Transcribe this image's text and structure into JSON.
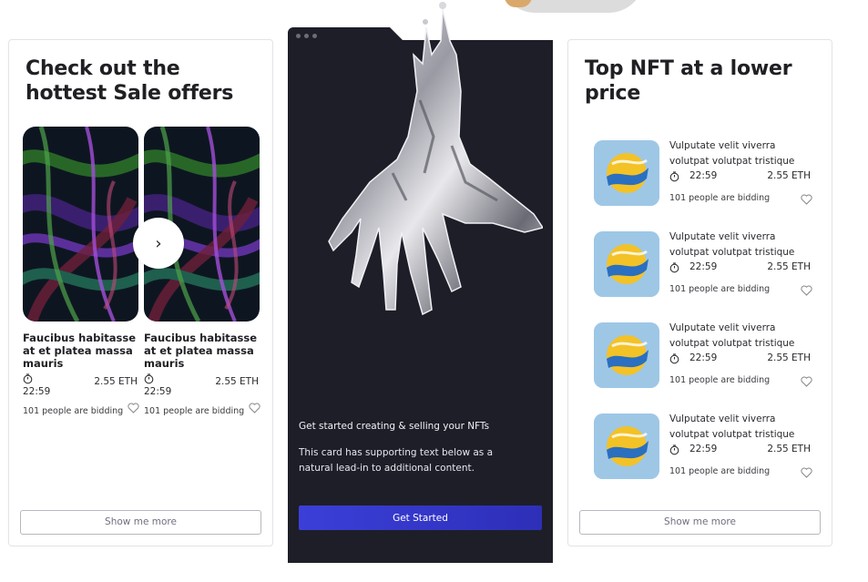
{
  "left_card": {
    "title": "Check out the hottest Sale offers",
    "items": [
      {
        "name": "Faucibus habitasse at et platea massa mauris",
        "time": "22:59",
        "price": "2.55 ETH",
        "bidding": "101 people are bidding"
      },
      {
        "name": "Faucibus habitasse at et platea massa mauris",
        "time": "22:59",
        "price": "2.55 ETH",
        "bidding": "101 people are bidding"
      }
    ],
    "next_icon": "›",
    "show_more": "Show me more"
  },
  "center_card": {
    "heading": "Get started creating & selling your NFTs",
    "text": "This card has supporting text below as a natural lead-in to additional content.",
    "button": "Get Started",
    "colors": {
      "background": "#1e1e28",
      "button": "#3338c9"
    }
  },
  "right_card": {
    "title": "Top NFT at a lower price",
    "items": [
      {
        "title": "Vulputate velit viverra volutpat volutpat tristique",
        "time": "22:59",
        "price": "2.55 ETH",
        "bidding": "101 people are bidding"
      },
      {
        "title": "Vulputate velit viverra volutpat volutpat tristique",
        "time": "22:59",
        "price": "2.55 ETH",
        "bidding": "101 people are bidding"
      },
      {
        "title": "Vulputate velit viverra volutpat volutpat tristique",
        "time": "22:59",
        "price": "2.55 ETH",
        "bidding": "101 people are bidding"
      },
      {
        "title": "Vulputate velit viverra volutpat volutpat tristique",
        "time": "22:59",
        "price": "2.55 ETH",
        "bidding": "101 people are bidding"
      }
    ],
    "show_more": "Show me more"
  },
  "icons": {
    "timer": "stopwatch-icon",
    "heart": "heart-icon",
    "next": "chevron-right-icon"
  }
}
